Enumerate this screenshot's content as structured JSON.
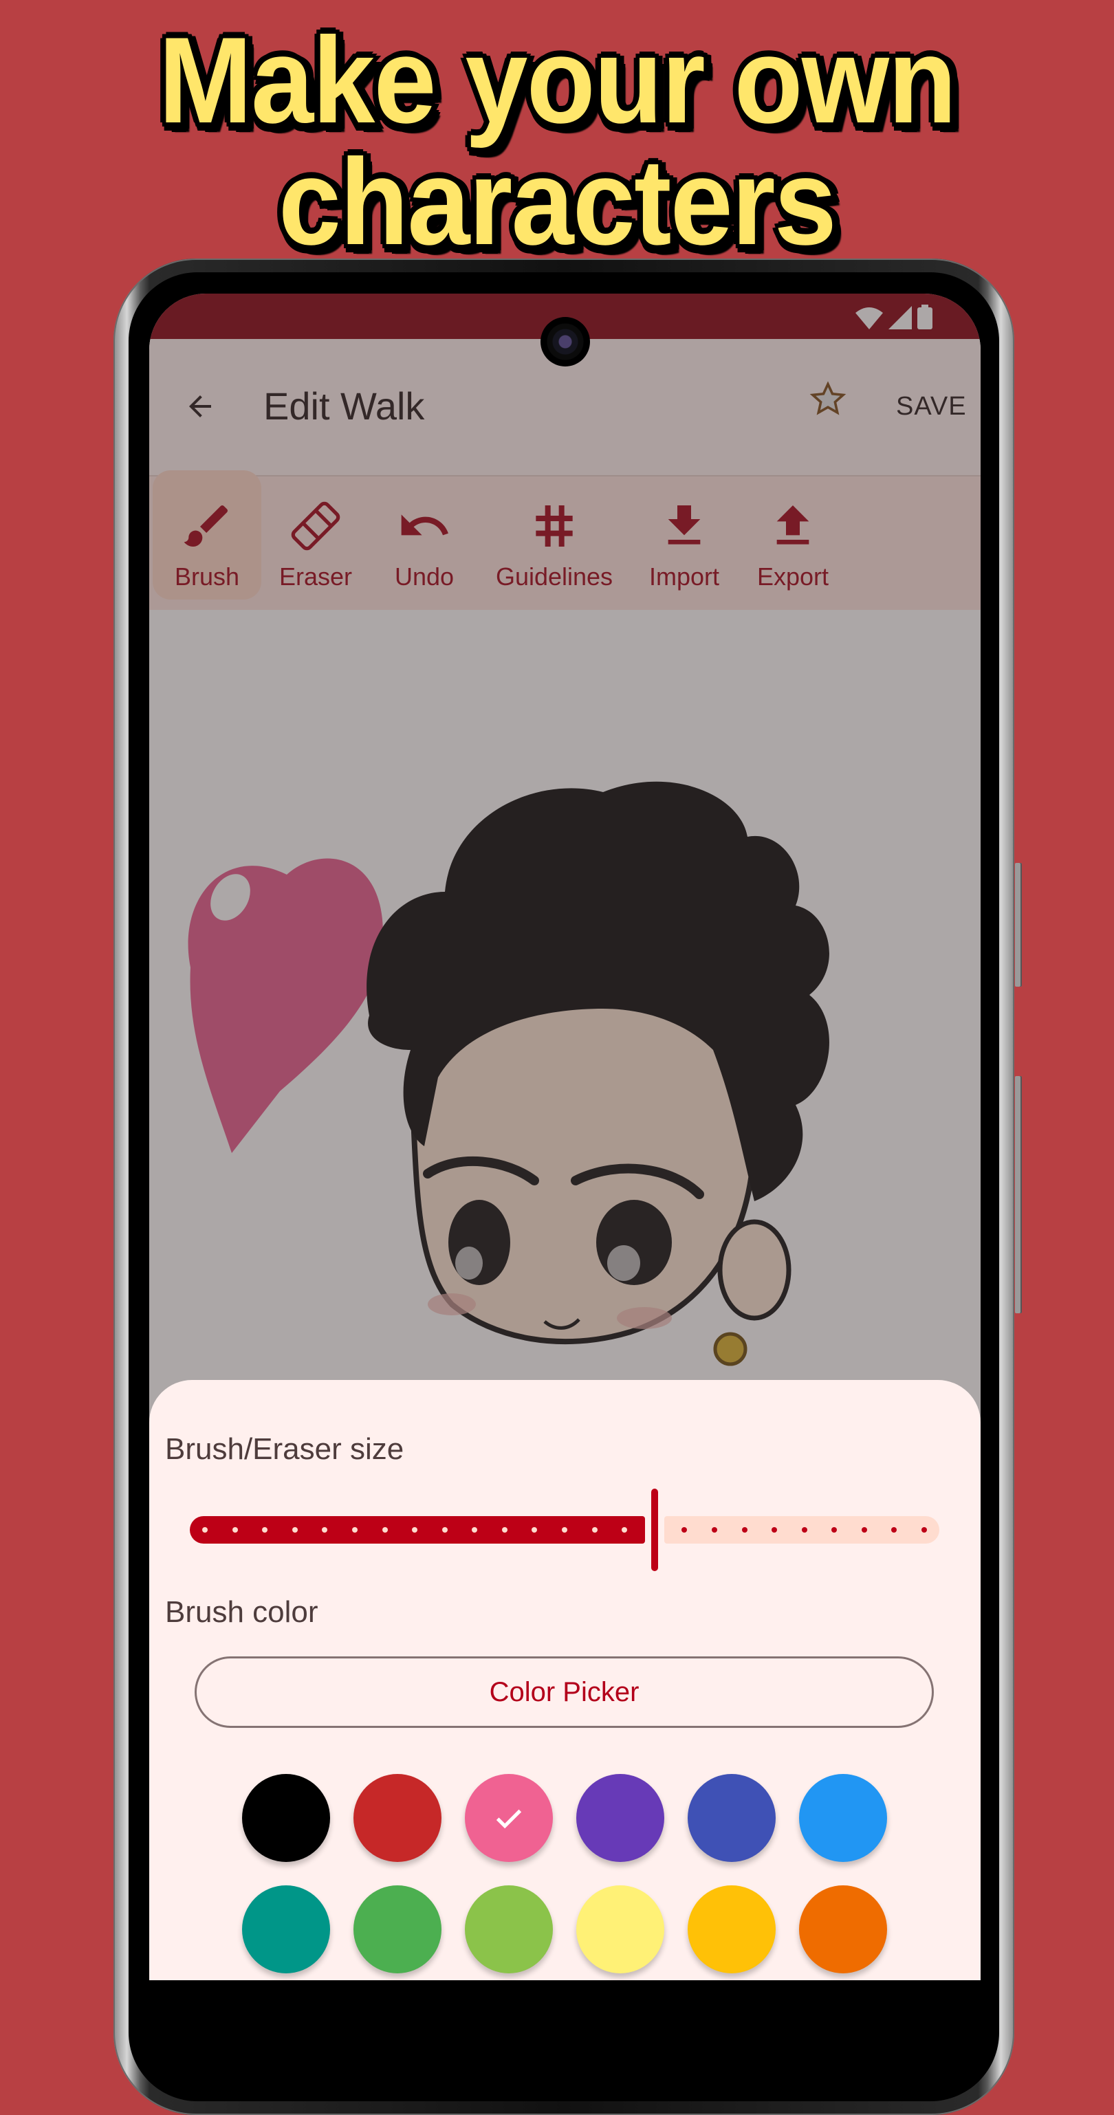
{
  "promo": {
    "headline_line1": "Make your own",
    "headline_line2": "characters"
  },
  "status_bar": {
    "icons": [
      "wifi-icon",
      "cellular-signal-icon",
      "battery-icon"
    ]
  },
  "app_bar": {
    "back_icon": "arrow-back-icon",
    "title": "Edit Walk",
    "favorite_icon": "star-outline-icon",
    "save_label": "SAVE"
  },
  "toolbar": {
    "tools": [
      {
        "label": "Brush",
        "icon": "brush-icon",
        "selected": true
      },
      {
        "label": "Eraser",
        "icon": "eraser-icon",
        "selected": false
      },
      {
        "label": "Undo",
        "icon": "undo-icon",
        "selected": false
      },
      {
        "label": "Guidelines",
        "icon": "grid-hash-icon",
        "selected": false
      },
      {
        "label": "Import",
        "icon": "download-icon",
        "selected": false
      },
      {
        "label": "Export",
        "icon": "upload-icon",
        "selected": false
      }
    ]
  },
  "canvas": {
    "content": "chibi character drawing with pink heart"
  },
  "bottom_sheet": {
    "size_label": "Brush/Eraser size",
    "size_slider": {
      "min": 0,
      "max": 24,
      "step": 1,
      "value": 15
    },
    "color_label": "Brush color",
    "color_picker_label": "Color Picker",
    "swatches": [
      {
        "name": "black",
        "color": "#000000"
      },
      {
        "name": "red",
        "color": "#c62828"
      },
      {
        "name": "pink",
        "color": "#f06292",
        "selected": true
      },
      {
        "name": "purple",
        "color": "#673ab7"
      },
      {
        "name": "indigo",
        "color": "#3f51b5"
      },
      {
        "name": "blue",
        "color": "#2196f3"
      },
      {
        "name": "teal",
        "color": "#009688"
      },
      {
        "name": "green",
        "color": "#4caf50"
      },
      {
        "name": "light-green",
        "color": "#8bc34a"
      },
      {
        "name": "yellow",
        "color": "#fff176"
      },
      {
        "name": "amber",
        "color": "#ffc107"
      },
      {
        "name": "orange",
        "color": "#ef6c00"
      }
    ]
  },
  "theme": {
    "background": "#b84043",
    "status_bar": "#85000f",
    "accent": "#bd0016",
    "headline_fill": "#ffe66b"
  }
}
